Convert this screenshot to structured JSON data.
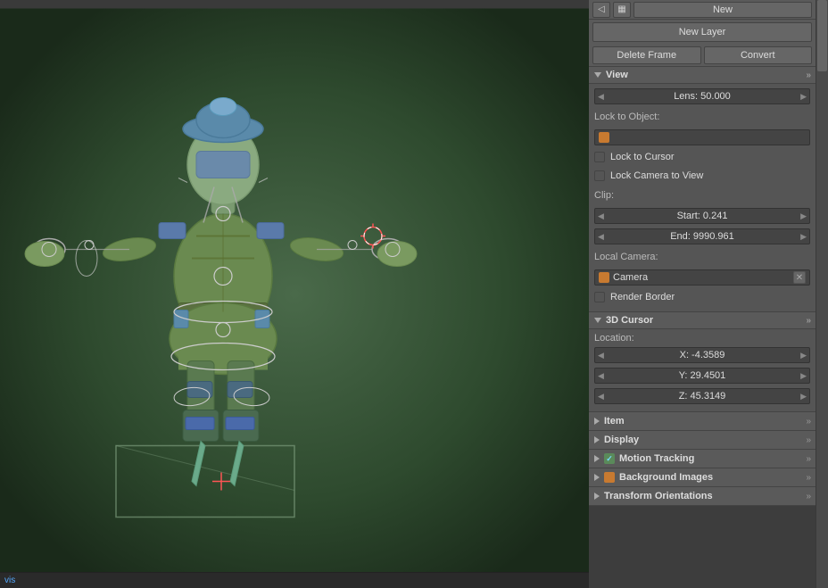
{
  "viewport": {
    "status_text": "vis"
  },
  "panel": {
    "toolbar": {
      "icon1": "◁",
      "icon2": "grid"
    },
    "new_button_label": "New",
    "new_layer_label": "New Layer",
    "delete_frame_label": "Delete Frame",
    "convert_label": "Convert",
    "sections": {
      "view": {
        "label": "View",
        "collapsed": false,
        "lens_label": "Lens: 50.000",
        "lock_to_object_label": "Lock to Object:",
        "lock_to_cursor_label": "Lock to Cursor",
        "lock_camera_to_view_label": "Lock Camera to View",
        "clip_label": "Clip:",
        "clip_start_label": "Start: 0.241",
        "clip_end_label": "End: 9990.961",
        "local_camera_label": "Local Camera:",
        "camera_name": "Camera",
        "render_border_label": "Render Border"
      },
      "cursor_3d": {
        "label": "3D Cursor",
        "collapsed": false,
        "location_label": "Location:",
        "x_label": "X: -4.3589",
        "y_label": "Y: 29.4501",
        "z_label": "Z: 45.3149"
      },
      "item": {
        "label": "Item",
        "collapsed": true
      },
      "display": {
        "label": "Display",
        "collapsed": true
      },
      "motion_tracking": {
        "label": "Motion Tracking",
        "collapsed": true,
        "has_checkbox": true
      },
      "background_images": {
        "label": "Background Images",
        "collapsed": true,
        "has_icon": true
      },
      "transform_orientations": {
        "label": "Transform Orientations",
        "collapsed": true
      }
    }
  }
}
